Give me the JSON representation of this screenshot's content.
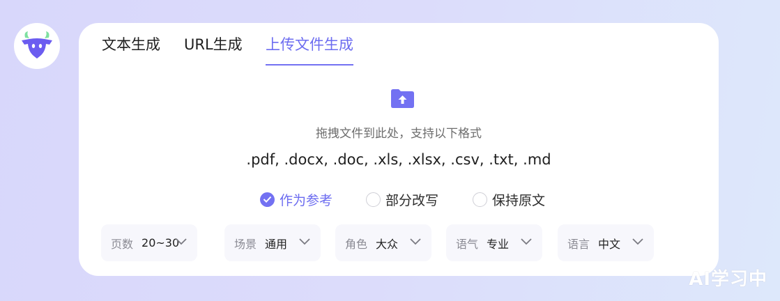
{
  "tabs": [
    {
      "label": "文本生成"
    },
    {
      "label": "URL生成"
    },
    {
      "label": "上传文件生成",
      "active": true
    }
  ],
  "upload": {
    "icon": "folder-upload-icon",
    "hint": "拖拽文件到此处，支持以下格式",
    "formats": ".pdf, .docx, .doc, .xls, .xlsx, .csv, .txt, .md"
  },
  "modes": [
    {
      "label": "作为参考",
      "checked": true
    },
    {
      "label": "部分改写",
      "checked": false
    },
    {
      "label": "保持原文",
      "checked": false
    }
  ],
  "selects": [
    {
      "label": "页数",
      "value": "20~30"
    },
    {
      "label": "场景",
      "value": "通用"
    },
    {
      "label": "角色",
      "value": "大众"
    },
    {
      "label": "语气",
      "value": "专业"
    },
    {
      "label": "语言",
      "value": "中文"
    }
  ],
  "watermark": "AI学习中",
  "colors": {
    "accent": "#7371f2",
    "logo_horns": "#7ee0a0",
    "logo_face": "#6b5cf0"
  }
}
